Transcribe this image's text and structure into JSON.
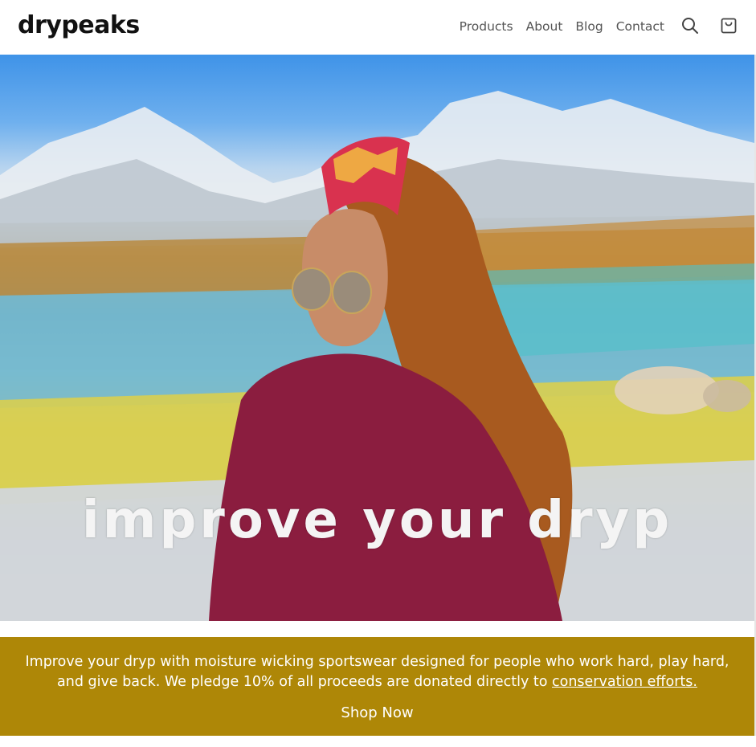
{
  "header": {
    "logo": "drypeaks",
    "nav": [
      "Products",
      "About",
      "Blog",
      "Contact"
    ],
    "icons": [
      "search-icon",
      "cart-icon"
    ]
  },
  "hero": {
    "overlay_text": "improve your dryp"
  },
  "promo": {
    "text_before_link": "Improve your dryp with moisture wicking sportswear designed for people who work hard, play hard, and give back. We pledge 10% of all proceeds are donated directly to ",
    "link_text": "conservation efforts.",
    "cta": "Shop Now",
    "background_color": "#ae8707"
  }
}
